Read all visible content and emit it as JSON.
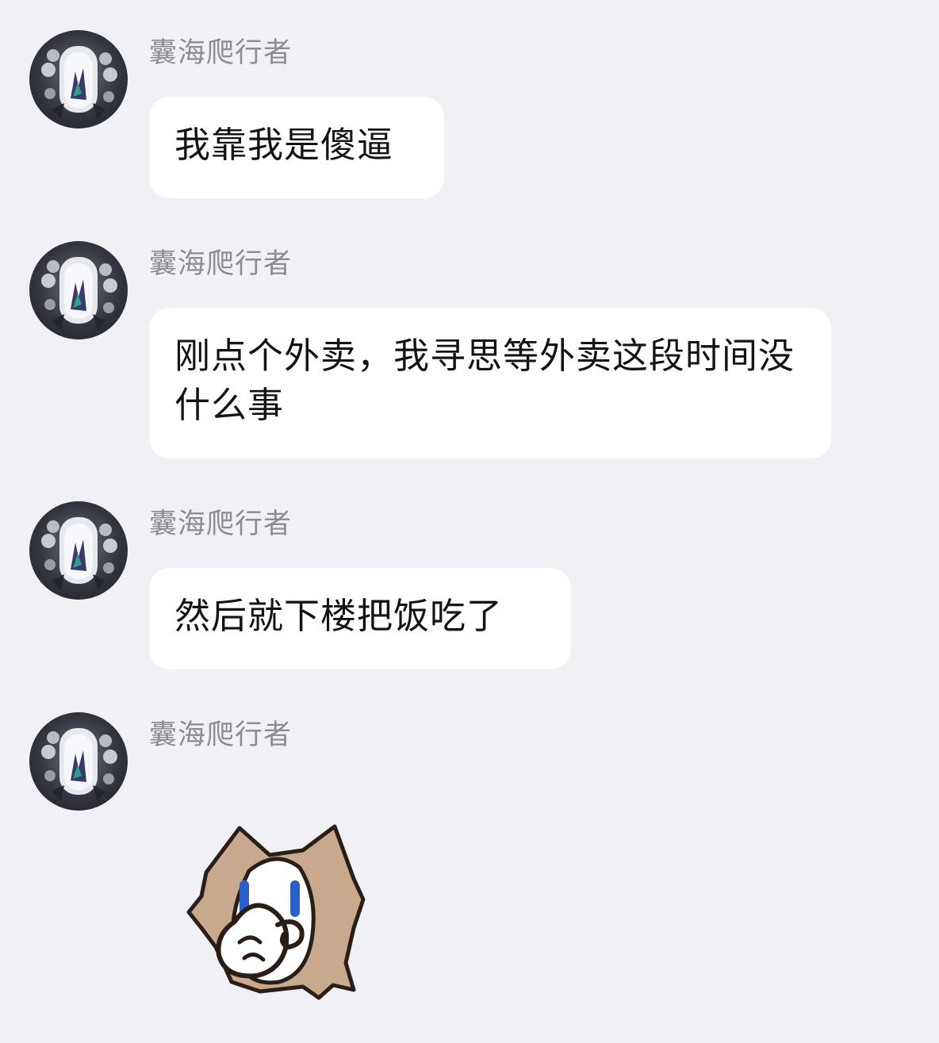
{
  "messages": [
    {
      "sender": "囊海爬行者",
      "text": "我靠我是傻逼"
    },
    {
      "sender": "囊海爬行者",
      "text": "刚点个外卖，我寻思等外卖这段时间没什么事"
    },
    {
      "sender": "囊海爬行者",
      "text": "然后就下楼把饭吃了"
    },
    {
      "sender": "囊海爬行者",
      "sticker": "cat-facepalm-sticker"
    }
  ],
  "icons": {
    "avatar": "creature-avatar-icon",
    "sticker": "cat-facepalm-icon"
  },
  "colors": {
    "background": "#f0f0f5",
    "bubble": "#ffffff",
    "sender_text": "#8c8c92",
    "message_text": "#141414"
  }
}
